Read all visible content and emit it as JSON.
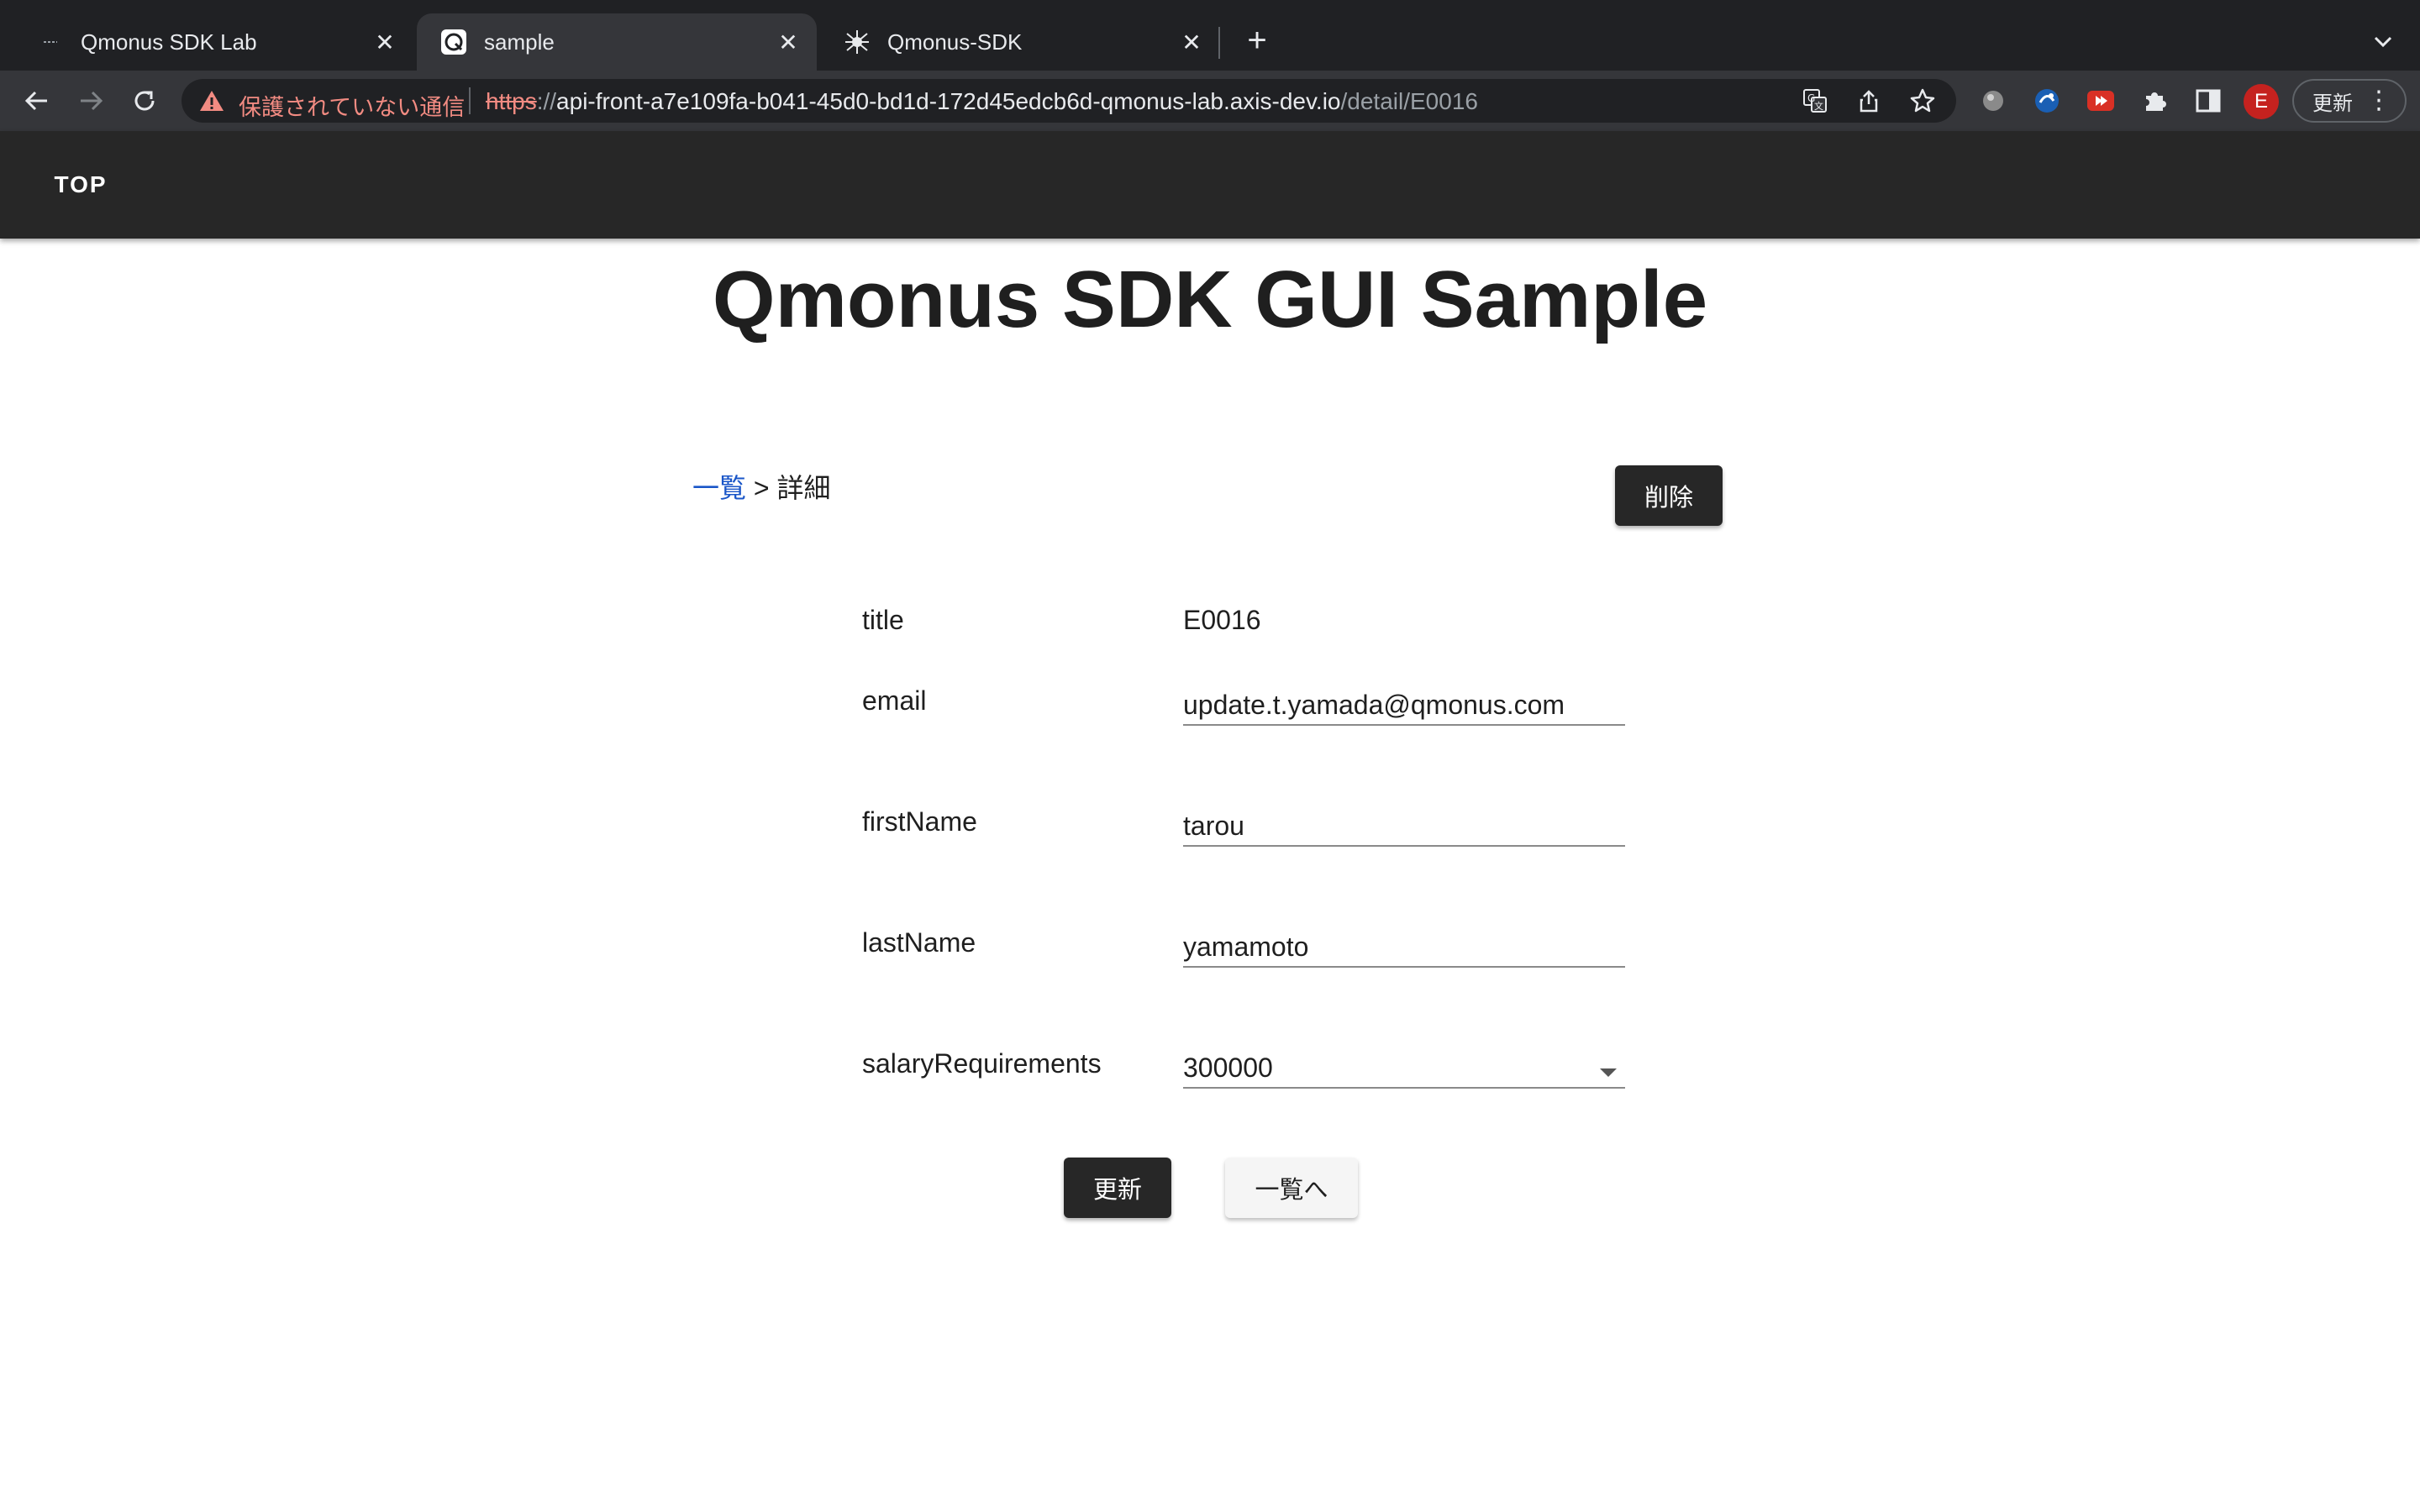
{
  "browser": {
    "tabs": [
      {
        "label": "Qmonus SDK Lab",
        "icon": "dash-favicon-icon"
      },
      {
        "label": "sample",
        "icon": "qmonus-favicon-icon"
      },
      {
        "label": "Qmonus-SDK",
        "icon": "spider-favicon-icon"
      }
    ],
    "address": {
      "security_text": "保護されていない通信",
      "scheme": "https",
      "scheme_sep": "://",
      "host": "api-front-a7e109fa-b041-45d0-bd1d-172d45edcb6d-qmonus-lab.axis-dev.io",
      "path": "/detail/E0016"
    },
    "profile_initial": "E",
    "update_label": "更新"
  },
  "app": {
    "nav_top": "TOP",
    "title": "Qmonus SDK GUI Sample",
    "breadcrumb": {
      "link": "一覧",
      "separator": " > ",
      "current": "詳細"
    },
    "delete_label": "削除",
    "fields": {
      "title": {
        "label": "title",
        "value": "E0016"
      },
      "email": {
        "label": "email",
        "value": "update.t.yamada@qmonus.com"
      },
      "firstName": {
        "label": "firstName",
        "value": "tarou"
      },
      "lastName": {
        "label": "lastName",
        "value": "yamamoto"
      },
      "salaryRequirements": {
        "label": "salaryRequirements",
        "value": "300000"
      }
    },
    "update_label": "更新",
    "back_label": "一覧へ"
  }
}
